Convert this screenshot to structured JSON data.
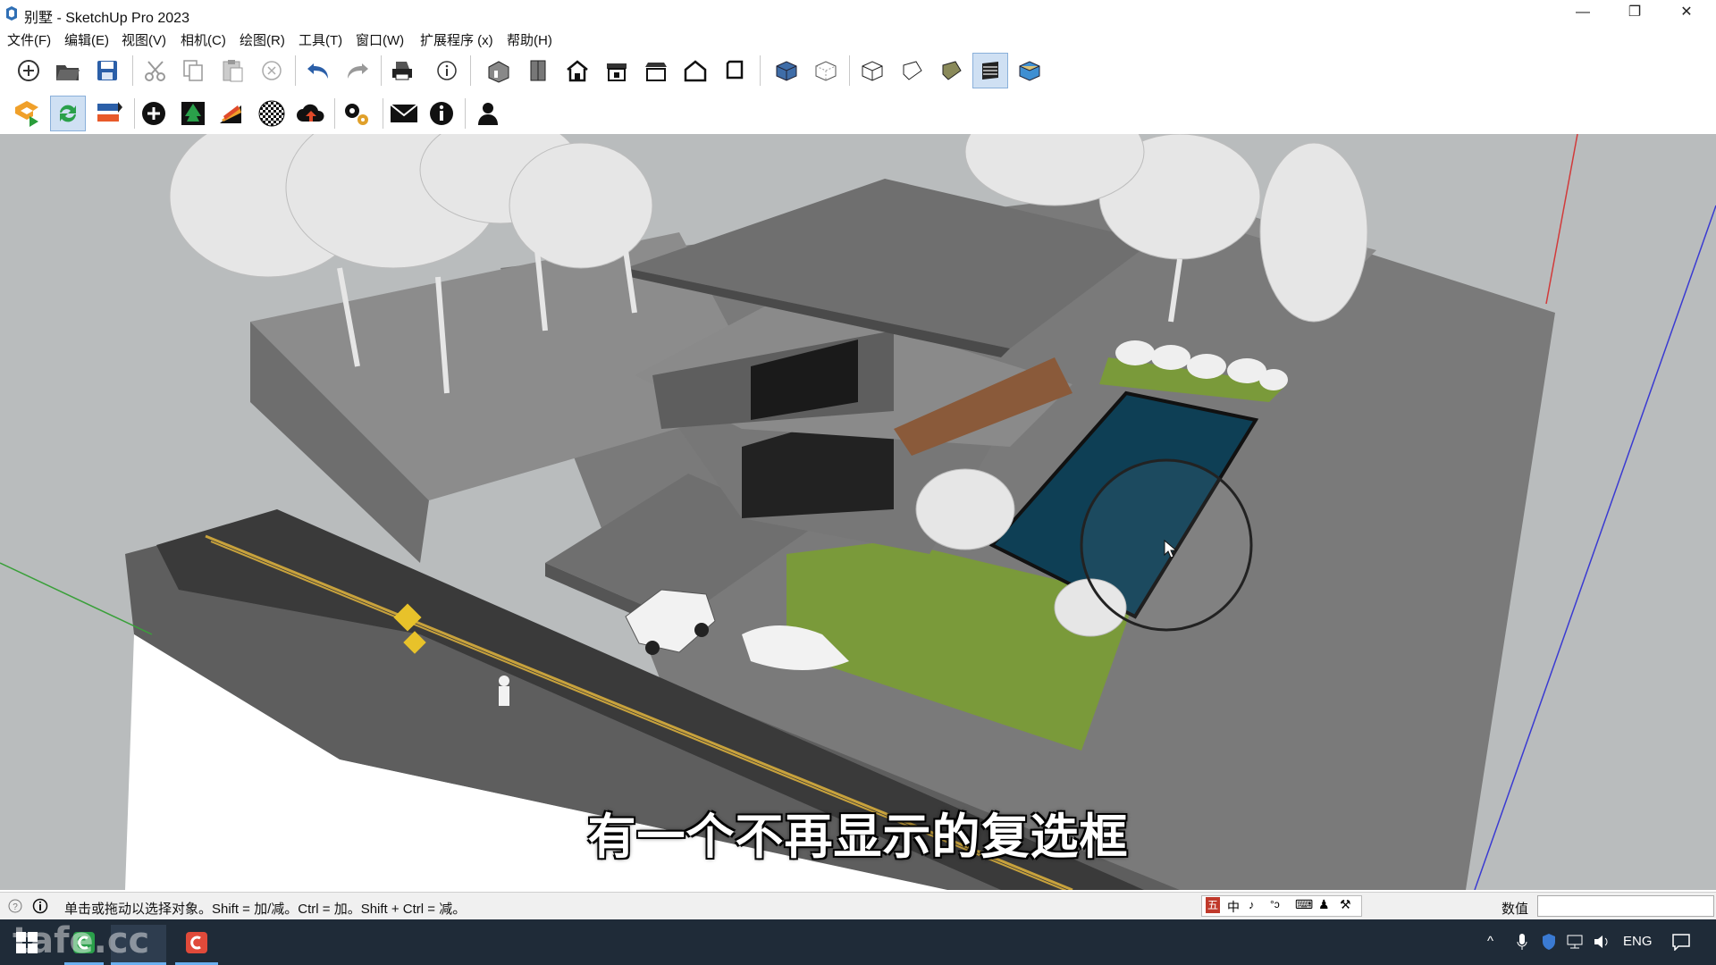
{
  "window": {
    "title": "别墅 - SketchUp Pro 2023",
    "minimize": "—",
    "restore": "❐",
    "close": "✕"
  },
  "menu": [
    "文件(F)",
    "编辑(E)",
    "视图(V)",
    "相机(C)",
    "绘图(R)",
    "工具(T)",
    "窗口(W)",
    "扩展程序 (x)",
    "帮助(H)"
  ],
  "toolbar_main": {
    "icons": [
      "new-icon",
      "open-icon",
      "save-icon",
      "cut-icon",
      "copy-icon",
      "paste-icon",
      "erase-icon",
      "undo-icon",
      "redo-icon",
      "print-icon",
      "model-info-icon",
      "iso-view-icon",
      "top-view-icon",
      "front-view-icon",
      "right-view-icon",
      "back-view-icon",
      "left-view-icon",
      "bottom-view-icon",
      "xray-icon",
      "backedges-icon",
      "wireframe-icon",
      "hidden-line-icon",
      "shaded-icon",
      "shaded-textures-icon",
      "monochrome-icon"
    ],
    "active": "shaded-textures-icon"
  },
  "toolbar_ext": {
    "icons": [
      "extension-logo-icon",
      "refresh-icon",
      "switch-icon",
      "add-icon",
      "tree-icon",
      "slope-icon",
      "checker-icon",
      "cloud-upload-icon",
      "settings-icon",
      "mail-icon",
      "info-icon",
      "user-icon"
    ]
  },
  "subtitle": "有一个不再显示的复选框",
  "status": {
    "message": "单击或拖动以选择对象。Shift = 加/减。Ctrl = 加。Shift + Ctrl = 减。",
    "measurement_label": "数值",
    "ime": [
      "中",
      "♪",
      "°ɔ",
      "⌨",
      "♟",
      "⚒"
    ]
  },
  "taskbar": {
    "watermark": "tafe.cc",
    "tray_lang": "ENG"
  },
  "colors": {
    "sky": "#b9bcbd",
    "roof": "#6f6f6f",
    "concrete": "#8a8a8a",
    "grass": "#7a9a3a",
    "pool": "#0e3f55",
    "road": "#3a3a3a",
    "road_line": "#c8a23c",
    "wood": "#8a5a3a",
    "taskbar": "#1f2b38"
  }
}
